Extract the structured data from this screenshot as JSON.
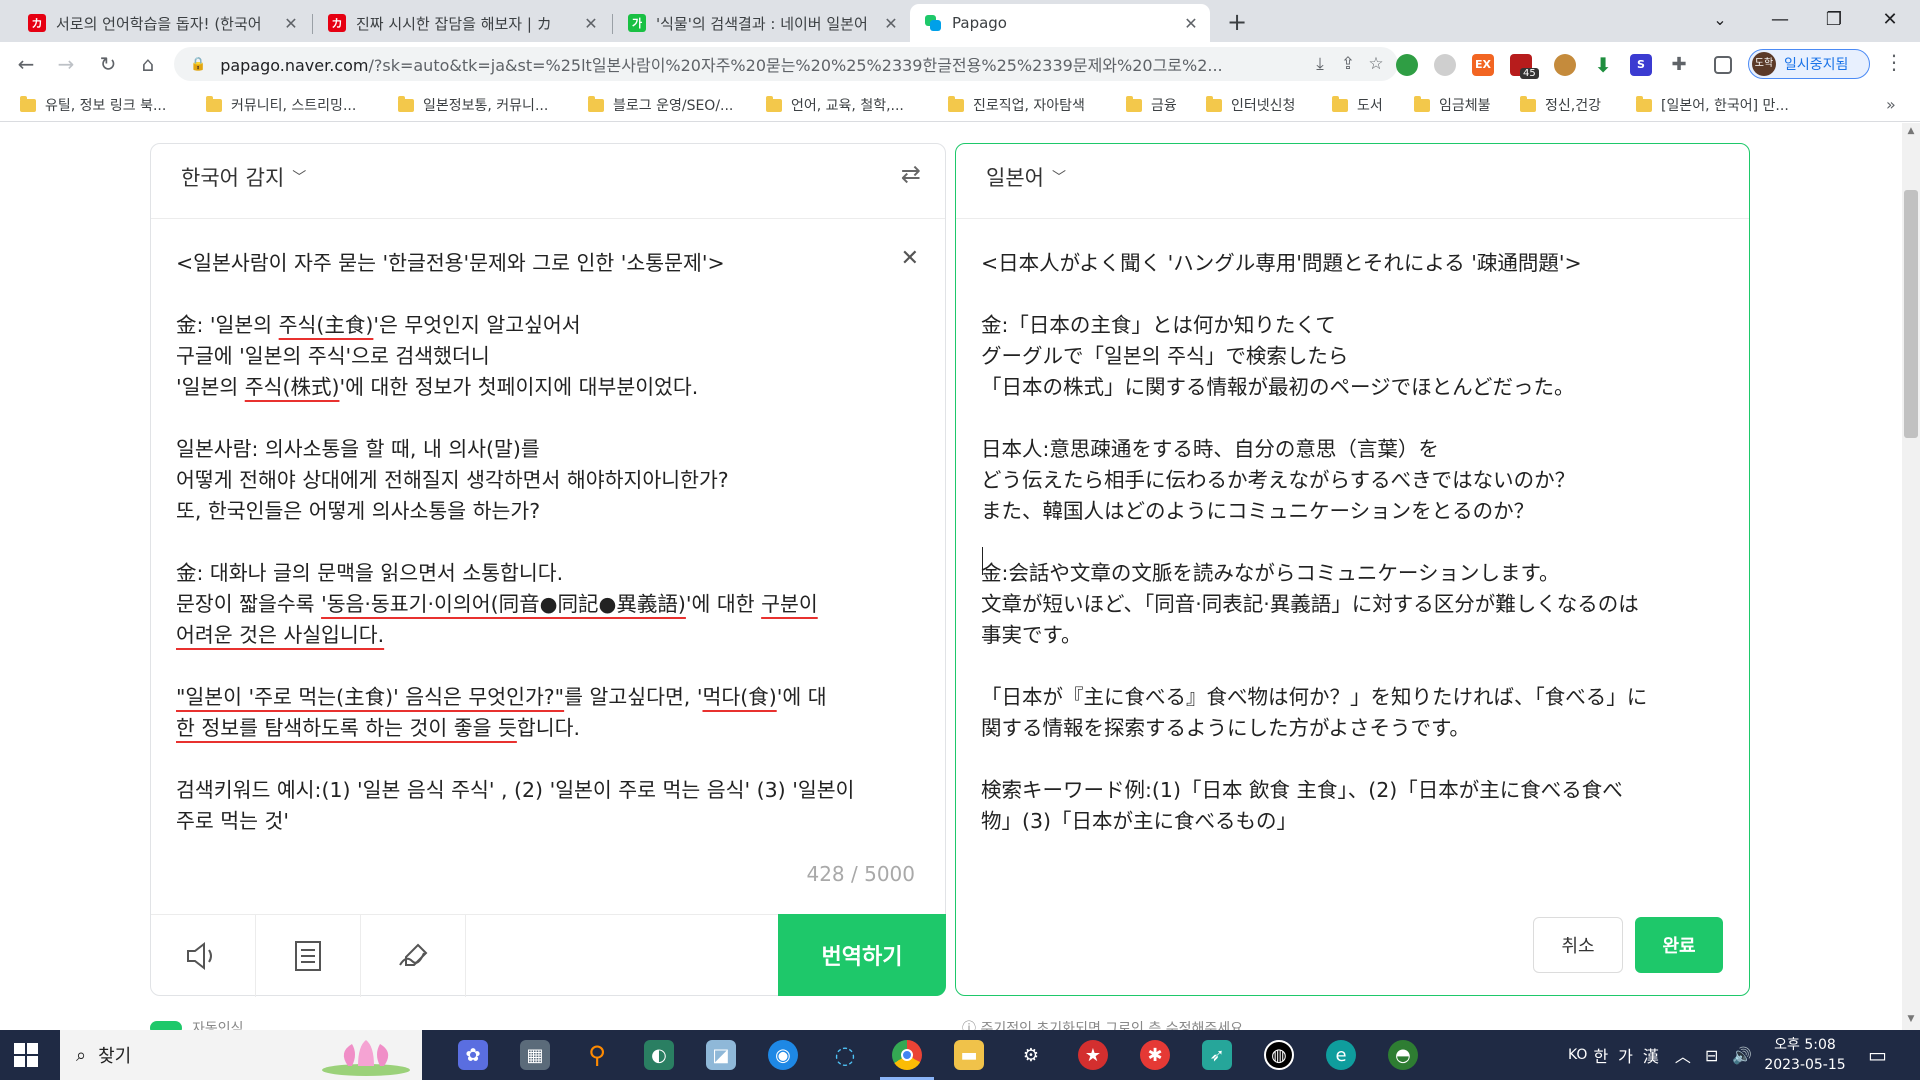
{
  "browser": {
    "tabs": [
      {
        "title": "서로의 언어학습을 돕자! (한국어",
        "favicon": "red-k-logo",
        "active": false
      },
      {
        "title": "진짜 시시한 잡담을 해보자 | カ",
        "favicon": "red-k-logo",
        "active": false
      },
      {
        "title": "'식물'의 검색결과 : 네이버 일본어",
        "favicon": "naver-dictionary-icon",
        "active": false
      },
      {
        "title": "Papago",
        "favicon": "papago-logo",
        "active": true
      }
    ],
    "url_host": "papago.naver.com",
    "url_rest": "/?sk=auto&tk=ja&st=%25lt일본사람이%20자주%20묻는%20%25%2339한글전용%25%2339문제와%20그로%2...",
    "profile_initials": "도학",
    "profile_label": "일시중지됨",
    "ext_badge": "45",
    "ext_label": "EX",
    "bookmarks": [
      "유틸, 정보 링크 북...",
      "커뮤니티, 스트리밍...",
      "일본정보통, 커뮤니...",
      "블로그 운영/SEO/...",
      "언어, 교육, 철학,...",
      "진로직업, 자아탐색",
      "금융",
      "인터넷신청",
      "도서",
      "임금체불",
      "정신,건강",
      "[일본어, 한국어] 만..."
    ],
    "bookmarks_more": "»"
  },
  "source": {
    "language": "한국어 감지",
    "counter": "428 / 5000",
    "translate_button": "번역하기",
    "lines": [
      [
        {
          "t": "<일본사람이 자주 묻는 '한글전용'문제와 그로 인한 '소통문제'>"
        }
      ],
      [
        {
          "t": ""
        }
      ],
      [
        {
          "t": "金: '일본의 "
        },
        {
          "t": "주식(主食)",
          "u": true
        },
        {
          "t": "'은 무엇인지 알고싶어서"
        }
      ],
      [
        {
          "t": "구글에 '일본의 주식'으로 검색했더니"
        }
      ],
      [
        {
          "t": "'일본의 "
        },
        {
          "t": "주식(株式)",
          "u": true
        },
        {
          "t": "'에 대한 정보가 첫페이지에 대부분이었다."
        }
      ],
      [
        {
          "t": ""
        }
      ],
      [
        {
          "t": "일본사람: 의사소통을 할 때, 내 의사(말)를"
        }
      ],
      [
        {
          "t": "어떻게 전해야 상대에게 전해질지 생각하면서 해야하지아니한가?"
        }
      ],
      [
        {
          "t": "또, 한국인들은 어떻게 의사소통을 하는가?"
        }
      ],
      [
        {
          "t": ""
        }
      ],
      [
        {
          "t": "金: 대화나 글의 문맥을 읽으면서 소통합니다."
        }
      ],
      [
        {
          "t": "문장이 짧을수록 "
        },
        {
          "t": "'동음·동표기·이의어(同音●同記●異義語)",
          "u": true
        },
        {
          "t": "'에 대한 "
        },
        {
          "t": "구분이",
          "u": true
        }
      ],
      [
        {
          "t": "어려운 것은 사실입니다.",
          "u": true
        }
      ],
      [
        {
          "t": ""
        }
      ],
      [
        {
          "t": "\"일본이 '주로 먹는(主食)' 음식은 무엇인가?\"",
          "u": true
        },
        {
          "t": "를 알고싶다면, '"
        },
        {
          "t": "먹다(食)",
          "u": true
        },
        {
          "t": "'에 대"
        }
      ],
      [
        {
          "t": "한 정보를 탐색하도록 하는 것이 좋을 듯",
          "u": true
        },
        {
          "t": "합니다."
        }
      ],
      [
        {
          "t": ""
        }
      ],
      [
        {
          "t": "검색키워드 예시:(1) '일본 음식 주식' , (2) '일본이 주로 먹는 음식' (3) '일본이"
        }
      ],
      [
        {
          "t": "주로 먹는 것'"
        }
      ]
    ]
  },
  "target": {
    "language": "일본어",
    "cancel_button": "취소",
    "done_button": "완료",
    "lines": [
      "<日本人がよく聞く 'ハングル専用'問題とそれによる '疎通問題'>",
      "",
      "金:「日本の主食」とは何か知りたくて",
      "グーグルで「일본의 주식」で検索したら",
      "「日本の株式」に関する情報が最初のページでほとんどだった。",
      "",
      "日本人:意思疎通をする時、自分の意思（言葉）を",
      "どう伝えたら相手に伝わるか考えながらするべきではないのか？",
      "また、韓国人はどのようにコミュニケーションをとるのか？",
      "",
      "金:会話や文章の文脈を読みながらコミュニケーションします。",
      "文章が短いほど、「同音·同表記·異義語」に対する区分が難しくなるのは",
      "事実です。",
      "",
      "「日本が『主に食べる』食べ物は何か？」を知りたければ、「食べる」に",
      "関する情報を探索するようにした方がよさそうです。",
      "",
      "検索キーワード例:(1)「日本 飲食 主食」、(2)「日本が主に食べる食べ",
      "物」(3)「日本が主に食べるもの」"
    ]
  },
  "below": {
    "left": "자동인식",
    "right": "주기적인 초기화되면 그로인 측 수정해주세요"
  },
  "taskbar": {
    "search_label": "찾기",
    "tray_lang": "KO",
    "tray_ime_1": "한",
    "tray_ime_2": "가",
    "tray_ime_3": "漢",
    "clock_time": "오후 5:08",
    "clock_date": "2023-05-15"
  },
  "colors": {
    "papago_green": "#1ec86a",
    "underline_red": "#e8312f",
    "taskbar": "#1f2a44"
  }
}
